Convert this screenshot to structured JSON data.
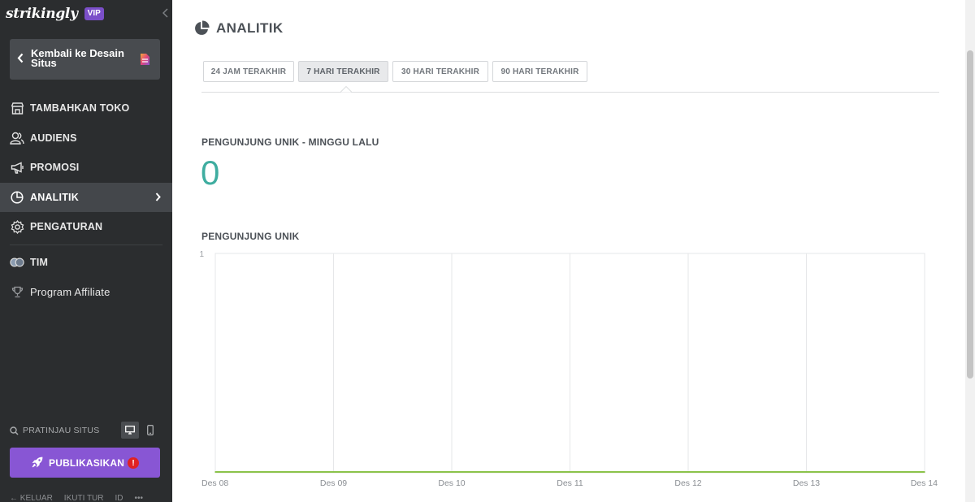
{
  "brand": {
    "logo_text": "strikingly",
    "badge": "VIP"
  },
  "sidebar": {
    "back_label": "Kembali ke Desain Situs",
    "items": [
      {
        "label": "TAMBAHKAN TOKO",
        "icon": "store-icon"
      },
      {
        "label": "AUDIENS",
        "icon": "audience-icon"
      },
      {
        "label": "PROMOSI",
        "icon": "megaphone-icon"
      },
      {
        "label": "ANALITIK",
        "icon": "pie-chart-icon",
        "active": true
      },
      {
        "label": "PENGATURAN",
        "icon": "gear-icon"
      },
      {
        "label": "TIM",
        "icon": "team-icon"
      },
      {
        "label": "Program Affiliate",
        "icon": "trophy-icon"
      }
    ],
    "preview_label": "PRATINJAU SITUS",
    "publish_label": "PUBLIKASIKAN",
    "publish_alert": "!",
    "footer": [
      "← KELUAR",
      "IKUTI TUR",
      "ID",
      "•••"
    ]
  },
  "main": {
    "title": "ANALITIK",
    "tabs": [
      {
        "label": "24 JAM TERAKHIR",
        "active": false
      },
      {
        "label": "7 HARI TERAKHIR",
        "active": true
      },
      {
        "label": "30 HARI TERAKHIR",
        "active": false
      },
      {
        "label": "90 HARI TERAKHIR",
        "active": false
      }
    ],
    "unique_visitors_last_week_label": "PENGUNJUNG UNIK - MINGGU LALU",
    "unique_visitors_last_week_value": "0",
    "chart_title": "PENGUNJUNG UNIK"
  },
  "colors": {
    "sidebar_bg": "#2b2d2f",
    "active_item_bg": "#44474b",
    "publish_purple": "#8856d4",
    "stat_teal": "#3fada0",
    "chart_line_green": "#8bc34a"
  },
  "chart_data": {
    "type": "line",
    "title": "PENGUNJUNG UNIK",
    "categories": [
      "Des 08",
      "Des 09",
      "Des 10",
      "Des 11",
      "Des 12",
      "Des 13",
      "Des 14"
    ],
    "series": [
      {
        "values": [
          0,
          0,
          0,
          0,
          0,
          0,
          0
        ]
      }
    ],
    "y_ticks": [
      "1"
    ],
    "ylim": [
      0,
      1
    ],
    "grid": true
  }
}
